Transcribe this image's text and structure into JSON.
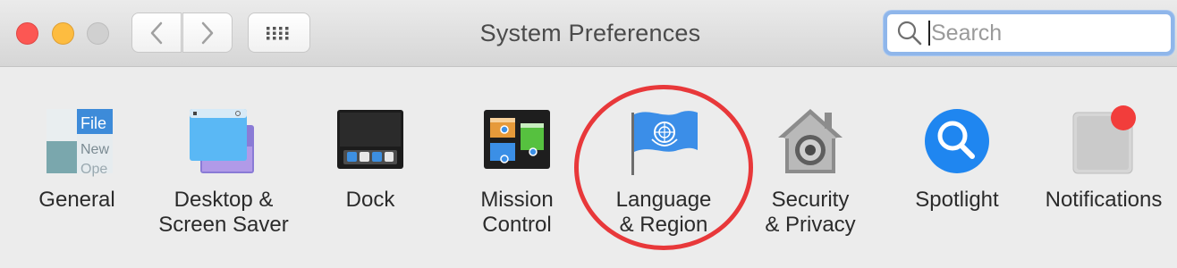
{
  "window": {
    "title": "System Preferences",
    "search_placeholder": "Search"
  },
  "toolbar": {
    "back_icon": "chevron-left-icon",
    "forward_icon": "chevron-right-icon",
    "show_all_icon": "grid-icon"
  },
  "traffic_lights": {
    "close_color": "#fc5753",
    "minimize_color": "#fdbc40",
    "zoom_color": "#d0d0d0"
  },
  "general_icon_text": {
    "file": "File",
    "new": "New",
    "open": "Ope"
  },
  "preferences": [
    {
      "id": "general",
      "label": "General",
      "icon": "general-icon"
    },
    {
      "id": "desktop",
      "label": "Desktop &\nScreen Saver",
      "icon": "desktop-screen-saver-icon"
    },
    {
      "id": "dock",
      "label": "Dock",
      "icon": "dock-icon"
    },
    {
      "id": "mission",
      "label": "Mission\nControl",
      "icon": "mission-control-icon"
    },
    {
      "id": "language",
      "label": "Language\n& Region",
      "icon": "un-flag-icon",
      "highlighted": true
    },
    {
      "id": "security",
      "label": "Security\n& Privacy",
      "icon": "house-lock-icon"
    },
    {
      "id": "spotlight",
      "label": "Spotlight",
      "icon": "spotlight-magnifier-icon"
    },
    {
      "id": "notifications",
      "label": "Notifications",
      "icon": "notifications-icon"
    }
  ],
  "annotation": {
    "color": "#e8383a",
    "target": "language"
  }
}
